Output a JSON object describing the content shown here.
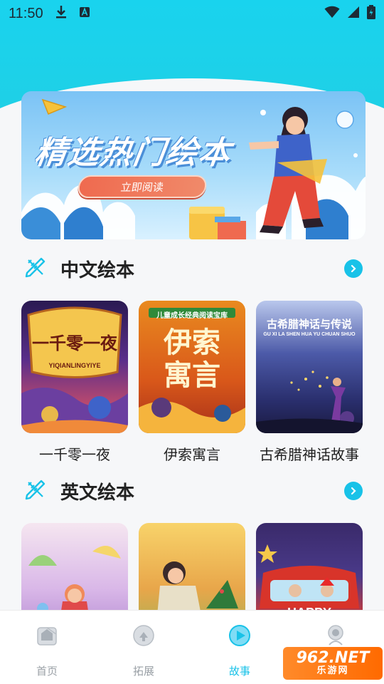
{
  "status_bar": {
    "time": "11:50"
  },
  "banner": {
    "title": "精选热门绘本",
    "button_label": "立即阅读"
  },
  "sections": [
    {
      "title": "中文绘本",
      "books": [
        {
          "label": "一千零一夜",
          "cover_title": "一千零一夜",
          "cover_sub": "YIQIANLINGYIYE"
        },
        {
          "label": "伊索寓言",
          "cover_title": "伊索寓言",
          "cover_sub": "儿童成长经典阅读宝库"
        },
        {
          "label": "古希腊神话故事",
          "cover_title": "古希腊神话与传说",
          "cover_sub": "GU XI LA SHEN HUA YU CHUAN SHUO"
        }
      ]
    },
    {
      "title": "英文绘本",
      "books": [
        {
          "label": "",
          "cover_title": "",
          "cover_sub": ""
        },
        {
          "label": "",
          "cover_title": "",
          "cover_sub": ""
        },
        {
          "label": "",
          "cover_title": "HAPPY",
          "cover_sub": ""
        }
      ]
    }
  ],
  "bottom_nav": [
    {
      "label": "首页",
      "icon": "home-icon",
      "active": false
    },
    {
      "label": "拓展",
      "icon": "expand-icon",
      "active": false
    },
    {
      "label": "故事",
      "icon": "story-icon",
      "active": true
    },
    {
      "label": "我的",
      "icon": "profile-icon",
      "active": false
    }
  ],
  "watermark": {
    "main": "962.NET",
    "sub": "乐游网"
  },
  "colors": {
    "accent": "#18c2e8",
    "top_bg": "#1fd0e6",
    "banner_button": "#ef6a4f"
  }
}
